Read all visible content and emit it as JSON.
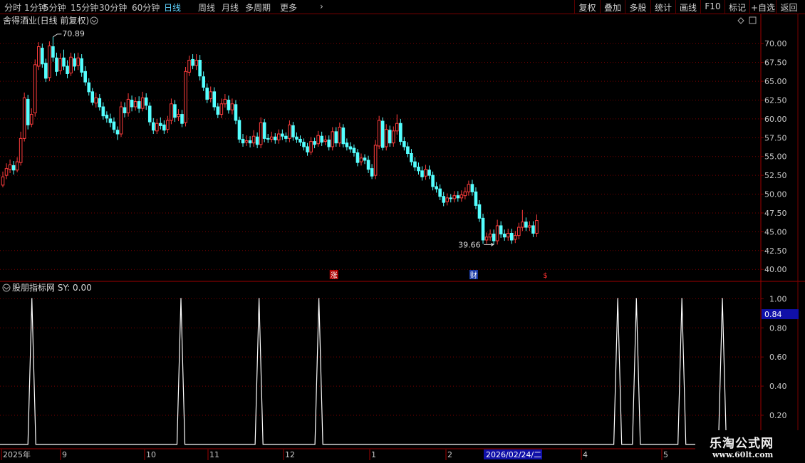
{
  "toolbar": {
    "left": [
      "分时",
      "1分钟",
      "5分钟",
      "15分钟",
      "30分钟",
      "60分钟",
      "日线",
      "周线",
      "月线",
      "多周期",
      "更多"
    ],
    "active": "日线",
    "right": [
      "复权",
      "叠加",
      "多股",
      "统计",
      "画线",
      "F10",
      "标记",
      "+自选",
      "返回"
    ]
  },
  "main_chart": {
    "title": "舍得酒业(日线 前复权)",
    "high_label": "70.89",
    "low_label": "39.66",
    "markers": [
      {
        "text": "涨",
        "bg": "#b00000",
        "color": "#ffffff",
        "index": 91
      },
      {
        "text": "财",
        "bg": "#1a3aa8",
        "color": "#ffffff",
        "index": 130
      },
      {
        "text": "$",
        "bg": "#000000",
        "color": "#ff3030",
        "index": 150
      }
    ]
  },
  "indicator": {
    "title": "股朋指标网 SY: 0.00",
    "cursor_value": "0.84"
  },
  "date_axis": {
    "labels": [
      "2025年",
      "9",
      "10",
      "11",
      "12",
      "1",
      "2",
      "4",
      "5"
    ],
    "highlight": "2026/02/24/二"
  },
  "colors": {
    "up": "#ff3c3c",
    "down": "#54ffff",
    "grid": "#7a0000",
    "spike": "#ffffff"
  },
  "watermark": {
    "title": "乐淘公式网",
    "url": "www.60lt.com"
  },
  "chart_data": [
    {
      "type": "candlestick",
      "name": "舍得酒业",
      "y_ticks": [
        40.0,
        42.5,
        45.0,
        47.5,
        50.0,
        52.5,
        55.0,
        57.5,
        60.0,
        62.5,
        65.0,
        67.5,
        70.0
      ],
      "ylim": [
        38.6,
        72.2
      ],
      "candles": [
        [
          51.2,
          52.3,
          53.0,
          50.9
        ],
        [
          52.5,
          53.4,
          54.1,
          52.0
        ],
        [
          53.3,
          53.9,
          54.6,
          52.8
        ],
        [
          53.8,
          53.2,
          54.4,
          52.6
        ],
        [
          53.2,
          54.3,
          54.9,
          52.9
        ],
        [
          54.2,
          57.4,
          58.3,
          53.8
        ],
        [
          57.4,
          62.8,
          63.5,
          57.0
        ],
        [
          62.6,
          59.2,
          63.2,
          58.6
        ],
        [
          59.3,
          60.6,
          61.4,
          58.9
        ],
        [
          60.8,
          67.2,
          67.9,
          60.3
        ],
        [
          67.0,
          69.6,
          70.2,
          66.5
        ],
        [
          69.4,
          67.3,
          70.0,
          66.8
        ],
        [
          67.4,
          65.4,
          68.0,
          64.9
        ],
        [
          65.5,
          69.7,
          70.3,
          65.0
        ],
        [
          69.6,
          68.2,
          70.89,
          67.6
        ],
        [
          68.1,
          66.3,
          68.8,
          65.7
        ],
        [
          66.4,
          68.0,
          68.7,
          65.9
        ],
        [
          68.1,
          67.0,
          69.2,
          66.5
        ],
        [
          67.0,
          66.0,
          67.8,
          65.4
        ],
        [
          66.1,
          68.2,
          68.8,
          65.7
        ],
        [
          68.0,
          67.0,
          68.7,
          66.4
        ],
        [
          67.1,
          68.1,
          68.8,
          66.5
        ],
        [
          68.0,
          66.2,
          68.6,
          65.6
        ],
        [
          66.3,
          64.9,
          67.0,
          64.4
        ],
        [
          64.8,
          63.6,
          65.4,
          63.1
        ],
        [
          63.6,
          62.2,
          64.1,
          61.8
        ],
        [
          62.1,
          62.8,
          63.5,
          61.5
        ],
        [
          62.7,
          61.6,
          63.3,
          61.1
        ],
        [
          61.6,
          60.4,
          62.2,
          59.9
        ],
        [
          60.5,
          60.1,
          61.0,
          59.5
        ],
        [
          60.0,
          59.5,
          60.7,
          58.9
        ],
        [
          59.6,
          58.6,
          60.2,
          58.1
        ],
        [
          58.5,
          58.0,
          59.0,
          57.2
        ],
        [
          58.0,
          61.6,
          62.3,
          57.6
        ],
        [
          61.5,
          60.8,
          62.2,
          60.2
        ],
        [
          60.8,
          62.6,
          63.4,
          60.3
        ],
        [
          62.5,
          61.6,
          63.1,
          61.0
        ],
        [
          61.6,
          62.3,
          62.9,
          61.1
        ],
        [
          62.3,
          61.4,
          63.0,
          60.8
        ],
        [
          61.4,
          62.8,
          63.6,
          61.0
        ],
        [
          62.8,
          61.8,
          63.4,
          61.2
        ],
        [
          61.7,
          59.6,
          62.2,
          59.1
        ],
        [
          59.5,
          58.5,
          60.1,
          58.0
        ],
        [
          58.4,
          59.4,
          60.0,
          58.0
        ],
        [
          59.4,
          59.1,
          60.2,
          58.6
        ],
        [
          59.2,
          58.5,
          59.8,
          58.0
        ],
        [
          58.6,
          59.8,
          60.4,
          58.1
        ],
        [
          59.8,
          62.0,
          62.7,
          59.3
        ],
        [
          61.9,
          60.2,
          62.5,
          59.6
        ],
        [
          60.3,
          60.6,
          61.3,
          59.7
        ],
        [
          60.6,
          59.4,
          61.2,
          58.9
        ],
        [
          59.5,
          66.3,
          66.9,
          59.0
        ],
        [
          66.2,
          67.8,
          68.4,
          65.7
        ],
        [
          67.9,
          67.1,
          68.6,
          66.6
        ],
        [
          67.1,
          67.8,
          68.6,
          66.5
        ],
        [
          67.8,
          65.7,
          68.5,
          65.1
        ],
        [
          65.6,
          64.2,
          66.3,
          63.7
        ],
        [
          64.1,
          62.6,
          64.7,
          62.1
        ],
        [
          62.7,
          63.6,
          64.3,
          62.2
        ],
        [
          63.6,
          61.6,
          64.2,
          61.1
        ],
        [
          61.6,
          60.6,
          62.1,
          60.1
        ],
        [
          60.6,
          62.0,
          62.7,
          60.1
        ],
        [
          62.0,
          62.6,
          63.3,
          61.5
        ],
        [
          62.5,
          61.2,
          63.1,
          60.7
        ],
        [
          61.2,
          62.0,
          62.7,
          60.6
        ],
        [
          61.9,
          59.8,
          62.5,
          59.3
        ],
        [
          59.8,
          57.3,
          60.3,
          56.8
        ],
        [
          57.3,
          56.8,
          58.0,
          56.3
        ],
        [
          56.9,
          57.1,
          57.8,
          56.4
        ],
        [
          57.1,
          56.8,
          57.7,
          56.2
        ],
        [
          56.8,
          57.7,
          58.5,
          56.3
        ],
        [
          57.6,
          56.6,
          58.2,
          56.1
        ],
        [
          56.6,
          59.5,
          60.2,
          56.1
        ],
        [
          59.5,
          57.4,
          60.0,
          56.9
        ],
        [
          57.4,
          57.3,
          58.0,
          56.8
        ],
        [
          57.3,
          57.6,
          58.3,
          56.9
        ],
        [
          57.6,
          57.2,
          58.1,
          56.7
        ],
        [
          57.2,
          58.0,
          58.6,
          56.7
        ],
        [
          58.0,
          57.7,
          58.6,
          57.2
        ],
        [
          57.7,
          57.4,
          58.2,
          56.9
        ],
        [
          57.4,
          59.2,
          59.8,
          56.9
        ],
        [
          59.1,
          57.6,
          59.6,
          57.1
        ],
        [
          57.6,
          57.3,
          58.2,
          56.8
        ],
        [
          57.3,
          56.9,
          57.8,
          56.4
        ],
        [
          56.9,
          56.3,
          57.4,
          55.8
        ],
        [
          56.3,
          55.6,
          56.8,
          55.1
        ],
        [
          55.6,
          57.0,
          57.6,
          55.2
        ],
        [
          57.0,
          56.6,
          57.5,
          56.1
        ],
        [
          56.7,
          57.8,
          58.4,
          56.3
        ],
        [
          57.7,
          56.9,
          58.3,
          56.4
        ],
        [
          57.0,
          57.2,
          57.8,
          56.5
        ],
        [
          57.2,
          56.3,
          57.8,
          55.8
        ],
        [
          56.3,
          58.3,
          58.9,
          55.8
        ],
        [
          58.3,
          56.8,
          58.9,
          56.3
        ],
        [
          56.8,
          58.9,
          59.5,
          56.3
        ],
        [
          58.8,
          56.7,
          59.3,
          56.2
        ],
        [
          56.8,
          56.3,
          57.4,
          55.8
        ],
        [
          56.3,
          56.0,
          56.9,
          55.5
        ],
        [
          56.1,
          55.5,
          56.6,
          55.0
        ],
        [
          55.5,
          54.2,
          56.0,
          53.7
        ],
        [
          54.3,
          54.8,
          55.4,
          53.8
        ],
        [
          54.8,
          54.5,
          55.3,
          54.0
        ],
        [
          54.5,
          53.3,
          55.1,
          52.8
        ],
        [
          53.4,
          52.4,
          54.0,
          52.0
        ],
        [
          52.5,
          56.5,
          57.2,
          52.0
        ],
        [
          56.4,
          59.8,
          60.4,
          56.0
        ],
        [
          59.7,
          56.2,
          60.2,
          55.8
        ],
        [
          56.3,
          58.6,
          59.3,
          55.8
        ],
        [
          58.5,
          56.8,
          59.1,
          56.3
        ],
        [
          56.8,
          58.4,
          59.0,
          56.3
        ],
        [
          58.4,
          59.4,
          60.6,
          57.9
        ],
        [
          59.4,
          57.0,
          60.0,
          56.5
        ],
        [
          57.0,
          56.3,
          57.6,
          55.8
        ],
        [
          56.3,
          55.4,
          56.9,
          54.9
        ],
        [
          55.4,
          54.3,
          56.0,
          53.8
        ],
        [
          54.3,
          53.6,
          54.9,
          53.1
        ],
        [
          53.6,
          53.1,
          54.2,
          52.6
        ],
        [
          53.1,
          52.3,
          53.7,
          51.8
        ],
        [
          52.4,
          53.3,
          53.9,
          51.9
        ],
        [
          53.2,
          52.5,
          53.8,
          52.0
        ],
        [
          52.5,
          51.0,
          53.0,
          50.5
        ],
        [
          51.0,
          50.7,
          51.6,
          50.2
        ],
        [
          50.7,
          49.7,
          51.3,
          49.2
        ],
        [
          49.7,
          48.9,
          50.3,
          48.4
        ],
        [
          49.0,
          49.5,
          50.1,
          48.5
        ],
        [
          49.5,
          49.4,
          50.0,
          48.9
        ],
        [
          49.4,
          49.8,
          50.4,
          48.9
        ],
        [
          49.8,
          49.5,
          50.4,
          49.0
        ],
        [
          49.5,
          49.9,
          50.5,
          49.0
        ],
        [
          49.8,
          50.3,
          50.9,
          49.3
        ],
        [
          50.3,
          51.3,
          51.8,
          49.8
        ],
        [
          51.3,
          50.3,
          51.9,
          49.8
        ],
        [
          50.3,
          48.5,
          50.9,
          48.0
        ],
        [
          48.6,
          46.8,
          49.2,
          46.3
        ],
        [
          46.8,
          43.9,
          47.4,
          43.4
        ],
        [
          43.9,
          44.3,
          44.9,
          43.4
        ],
        [
          44.3,
          44.7,
          45.3,
          43.8
        ],
        [
          44.7,
          43.8,
          45.3,
          43.3
        ],
        [
          43.8,
          45.8,
          46.6,
          43.3
        ],
        [
          45.8,
          44.7,
          46.4,
          44.2
        ],
        [
          44.7,
          44.3,
          45.3,
          43.8
        ],
        [
          44.3,
          44.8,
          45.4,
          43.8
        ],
        [
          44.8,
          43.9,
          45.4,
          43.4
        ],
        [
          44.0,
          44.5,
          45.1,
          43.5
        ],
        [
          44.5,
          45.6,
          46.2,
          44.0
        ],
        [
          45.6,
          46.3,
          47.9,
          45.1
        ],
        [
          46.3,
          45.6,
          46.9,
          45.1
        ],
        [
          45.6,
          45.8,
          46.4,
          45.1
        ],
        [
          45.8,
          44.8,
          46.4,
          44.3
        ],
        [
          44.8,
          46.5,
          47.3,
          44.3
        ]
      ]
    },
    {
      "type": "line",
      "name": "SY",
      "y_ticks": [
        0.2,
        0.4,
        0.6,
        0.8,
        1.0
      ],
      "ylim": [
        -0.03,
        1.08
      ],
      "x": [
        0,
        7.0,
        8.1,
        9.2,
        300
      ],
      "values": [
        0,
        0,
        1,
        0,
        0
      ],
      "spikes": [
        8.1,
        49.7,
        71.5,
        88.2,
        171.6,
        176.8,
        189.5,
        200.8
      ],
      "width": 1.1
    }
  ]
}
